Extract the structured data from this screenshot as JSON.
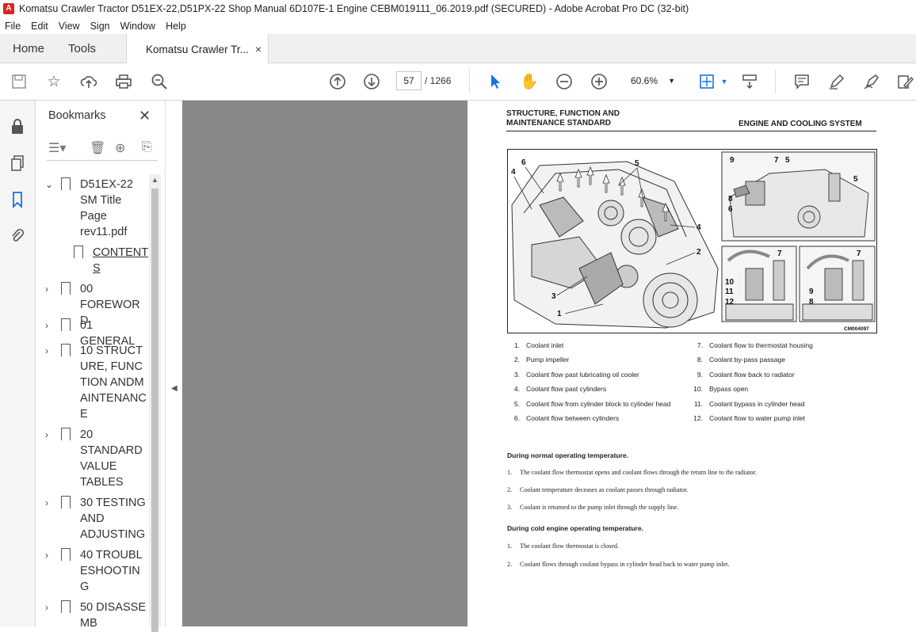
{
  "window": {
    "title": "Komatsu Crawler Tractor D51EX-22,D51PX-22 Shop Manual 6D107E-1 Engine CEBM019111_06.2019.pdf (SECURED) - Adobe Acrobat Pro DC (32-bit)",
    "menu": [
      "File",
      "Edit",
      "View",
      "Sign",
      "Window",
      "Help"
    ]
  },
  "tabs": {
    "home": "Home",
    "tools": "Tools",
    "document": "Komatsu Crawler Tr...",
    "close": "×"
  },
  "toolbar": {
    "page_current": "57",
    "page_total": "/ 1266",
    "zoom": "60.6%"
  },
  "bookmarks": {
    "title": "Bookmarks",
    "items": [
      {
        "label": "D51EX-22 SM Title Page rev11.pdf",
        "expanded": true
      },
      {
        "label": "CONTENTS",
        "child": true
      },
      {
        "label": "00 FOREWORD"
      },
      {
        "label": "01 GENERAL"
      },
      {
        "label": "10 STRUCTURE, FUNCTION ANDMAINTENANCE"
      },
      {
        "label": "20 STANDARD VALUE TABLES"
      },
      {
        "label": "30 TESTING AND ADJUSTING"
      },
      {
        "label": "40 TROUBLESHOOTING"
      },
      {
        "label": "50 DISASSEMB"
      }
    ]
  },
  "page": {
    "header_left_1": "STRUCTURE, FUNCTION AND",
    "header_left_2": "MAINTENANCE STANDARD",
    "header_right": "ENGINE AND COOLING SYSTEM",
    "figure_code": "CM004097",
    "legend_left": [
      {
        "n": "1.",
        "t": "Coolant inlet"
      },
      {
        "n": "2.",
        "t": "Pump impeller"
      },
      {
        "n": "3.",
        "t": "Coolant flow past lubricating oil cooler"
      },
      {
        "n": "4.",
        "t": "Coolant flow past cylinders"
      },
      {
        "n": "5.",
        "t": "Coolant flow from cylinder block to cylinder head"
      },
      {
        "n": "6.",
        "t": "Coolant flow between cylinders"
      }
    ],
    "legend_right": [
      {
        "n": "7.",
        "t": "Coolant flow to thermostat housing"
      },
      {
        "n": "8.",
        "t": "Coolant by-pass passage"
      },
      {
        "n": "9.",
        "t": "Coolant flow back to radiator"
      },
      {
        "n": "10.",
        "t": "Bypass open"
      },
      {
        "n": "11.",
        "t": "Coolant bypass in cylinder head"
      },
      {
        "n": "12.",
        "t": "Coolant flow to water pump inlet"
      }
    ],
    "section1_title": "During normal operating temperature.",
    "section1": [
      {
        "n": "1.",
        "t": "The coolant flow thermostat opens and coolant flows through the return line to the radiator."
      },
      {
        "n": "2.",
        "t": "Coolant temperature deceases as coolant passes through radiator."
      },
      {
        "n": "3.",
        "t": "Coolant is returned to the pump inlet through the supply line."
      }
    ],
    "section2_title": "During cold engine operating temperature.",
    "section2": [
      {
        "n": "1.",
        "t": "The coolant flow thermostat is closed."
      },
      {
        "n": "2.",
        "t": "Coolant flows through coolant bypass in cylinder head back to water pump inlet."
      }
    ],
    "callouts_main": [
      "6",
      "4",
      "5",
      "4",
      "2",
      "3",
      "1"
    ],
    "callouts_tr": [
      "9",
      "7",
      "5",
      "8",
      "6",
      "5"
    ],
    "callouts_bl": [
      "7",
      "10",
      "11",
      "12"
    ],
    "callouts_br": [
      "7",
      "9",
      "8"
    ]
  },
  "colors": {
    "viewer_bg": "#888888",
    "acrobat_red": "#d7261e",
    "select_blue": "#1473e6"
  }
}
